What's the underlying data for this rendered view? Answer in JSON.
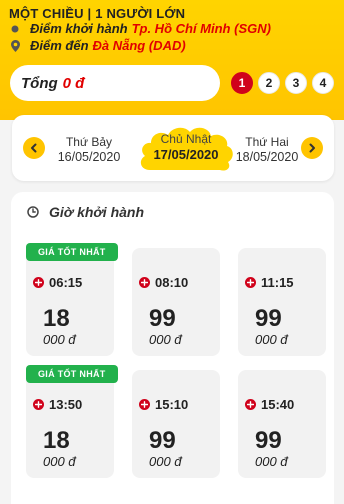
{
  "header": {
    "trip_type": "MỘT CHIỀU | 1 NGƯỜI LỚN",
    "from_label": "Điểm khởi hành",
    "from_city": "Tp. Hồ Chí Minh (SGN)",
    "to_label": "Điểm đến",
    "to_city": "Đà Nẵng (DAD)"
  },
  "total": {
    "label": "Tổng",
    "amount": "0 đ"
  },
  "steps": [
    "1",
    "2",
    "3",
    "4"
  ],
  "active_step": "1",
  "dates": {
    "prev": {
      "weekday": "Thứ Bảy",
      "date": "16/05/2020"
    },
    "current": {
      "weekday": "Chủ Nhật",
      "date": "17/05/2020"
    },
    "next": {
      "weekday": "Thứ Hai",
      "date": "18/05/2020"
    }
  },
  "flights_panel": {
    "title": "Giờ khởi hành",
    "flights": [
      {
        "badge": "GIÁ TỐT NHẤT",
        "time": "06:15",
        "price_main": "18",
        "price_sub": "000 đ"
      },
      {
        "badge": "",
        "time": "08:10",
        "price_main": "99",
        "price_sub": "000 đ"
      },
      {
        "badge": "",
        "time": "11:15",
        "price_main": "99",
        "price_sub": "000 đ"
      },
      {
        "badge": "GIÁ TỐT NHẤT",
        "time": "13:50",
        "price_main": "18",
        "price_sub": "000 đ"
      },
      {
        "badge": "",
        "time": "15:10",
        "price_main": "99",
        "price_sub": "000 đ"
      },
      {
        "badge": "",
        "time": "15:40",
        "price_main": "99",
        "price_sub": "000 đ"
      }
    ]
  },
  "colors": {
    "brand_yellow": "#ffc400",
    "accent_red": "#e10000",
    "best_price_green": "#22b14c",
    "card_bg": "#f2f2f2"
  },
  "icons": {
    "origin": "origin-dot-icon",
    "destination": "location-pin-icon",
    "prev_date": "chevron-left-icon",
    "next_date": "chevron-right-icon",
    "departure_time": "clock-icon",
    "flight": "plane-icon"
  }
}
